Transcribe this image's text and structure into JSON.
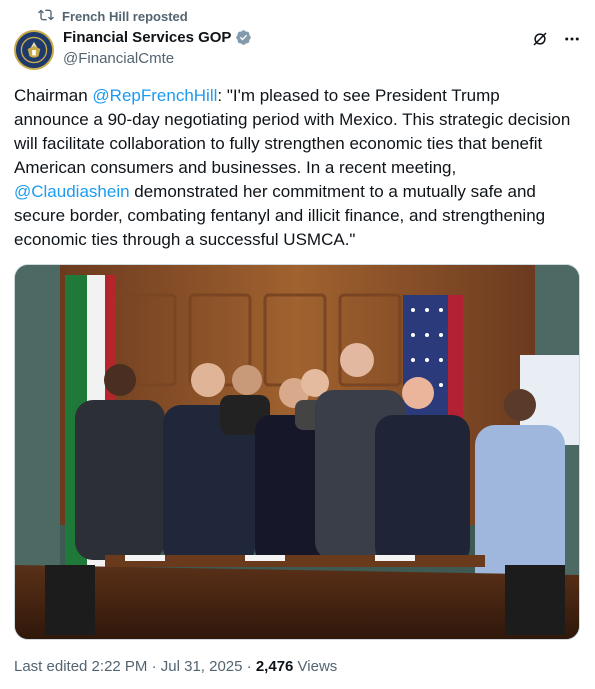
{
  "repost": {
    "label": "French Hill reposted"
  },
  "author": {
    "display_name": "Financial Services GOP",
    "handle": "@FinancialCmte"
  },
  "tweet": {
    "prefix": "Chairman ",
    "mention1": "@RepFrenchHill",
    "middle": ": \"I'm pleased to see President Trump announce a 90-day negotiating period with Mexico. This strategic decision will facilitate collaboration to fully strengthen economic ties that benefit American consumers and businesses. In a recent meeting, ",
    "mention2": "@Claudiashein",
    "suffix": " demonstrated her commitment to a mutually safe and secure border, combating fentanyl and illicit finance, and strengthening economic ties through a successful USMCA.\""
  },
  "footer": {
    "edited": "Last edited 2:22 PM",
    "sep1": " · ",
    "date": "Jul 31, 2025",
    "sep2": " · ",
    "views_count": "2,476",
    "views_label": " Views"
  },
  "colors": {
    "link": "#1d9bf0",
    "secondary": "#536471",
    "primary": "#0f1419",
    "verified": "#829aab"
  },
  "icons": {
    "repost": "repost-icon",
    "verified": "verified-badge-icon",
    "grok": "grok-icon",
    "more": "more-icon"
  }
}
